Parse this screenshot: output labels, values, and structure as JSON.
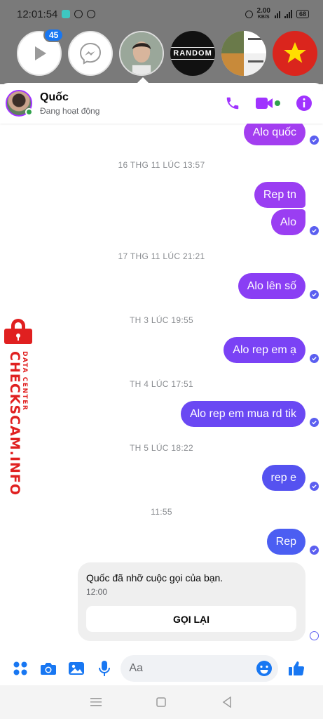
{
  "status_bar": {
    "time": "12:01:54",
    "net_speed": "2.00",
    "net_unit": "KB/S",
    "battery": "68"
  },
  "chat_heads": {
    "badge_count": "45",
    "random_label": "RANDOM"
  },
  "header": {
    "name": "Quốc",
    "status": "Đang hoạt động"
  },
  "messages": [
    {
      "type": "sent",
      "text": "Alo quốc",
      "color": "#a33ef0"
    },
    {
      "type": "time",
      "text": "16 THG 11 LÚC 13:57"
    },
    {
      "type": "sent",
      "text": "Rep tn",
      "color": "#9a3ef2"
    },
    {
      "type": "sent",
      "text": "Alo",
      "color": "#9a3ef2"
    },
    {
      "type": "time",
      "text": "17 THG 11 LÚC 21:21"
    },
    {
      "type": "sent",
      "text": "Alo lên số",
      "color": "#8a3ef4"
    },
    {
      "type": "time",
      "text": "TH 3 LÚC 19:55"
    },
    {
      "type": "sent",
      "text": "Alo rep em ạ",
      "color": "#7a42f5"
    },
    {
      "type": "time",
      "text": "TH 4 LÚC 17:51"
    },
    {
      "type": "sent",
      "text": "Alo rep em mua rd tik",
      "color": "#6a48f3"
    },
    {
      "type": "time",
      "text": "TH 5 LÚC 18:22"
    },
    {
      "type": "sent",
      "text": "rep e",
      "color": "#5552f0"
    },
    {
      "type": "time",
      "text": "11:55"
    },
    {
      "type": "sent",
      "text": "Rep",
      "color": "#4b5ef2"
    }
  ],
  "missed_call": {
    "text": "Quốc đã nhỡ cuộc gọi của bạn.",
    "time": "12:00",
    "button": "GỌI LẠI"
  },
  "watermark": {
    "main": "CHECKSCAM.INFO",
    "sub": "DATA CENTER"
  },
  "composer": {
    "placeholder": "Aa"
  },
  "colors": {
    "accent": "#a033ff",
    "seen": "#5b5ff0",
    "watermark": "#e02020"
  }
}
